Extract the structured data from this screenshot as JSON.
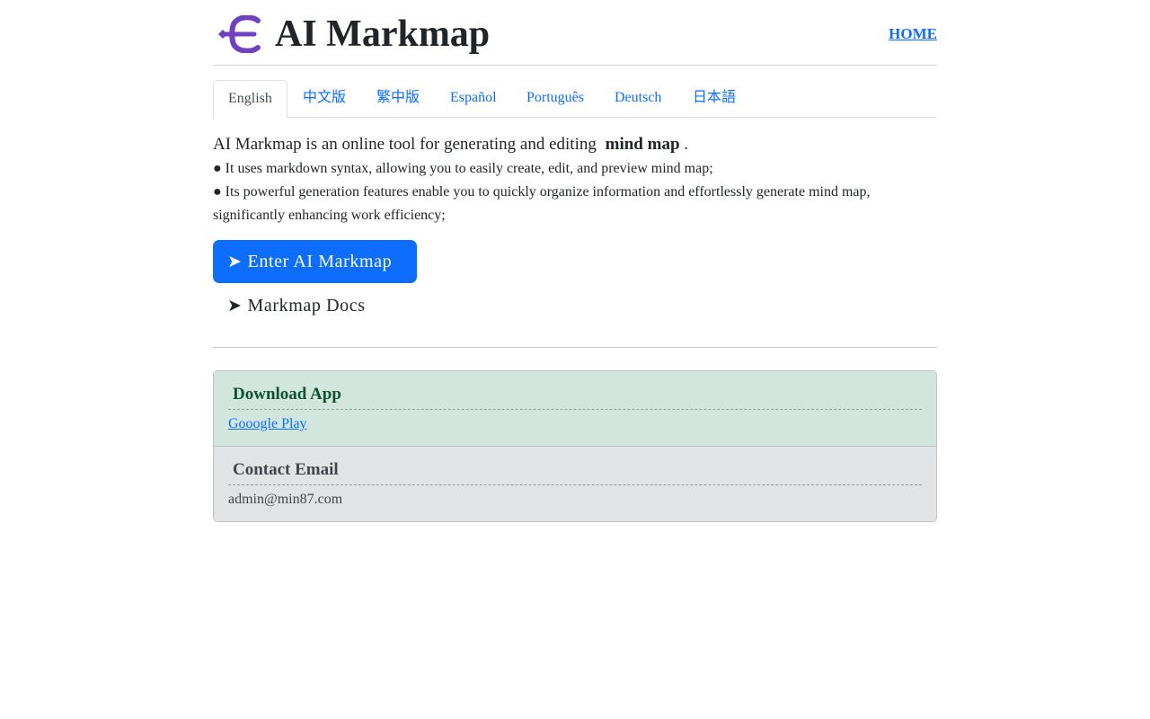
{
  "header": {
    "logo_icon": "purple-euro-arrow-logo",
    "title": "AI Markmap",
    "home_link": "HOME"
  },
  "tabs": [
    {
      "label": "English",
      "active": true
    },
    {
      "label": "中文版",
      "active": false
    },
    {
      "label": "繁中版",
      "active": false
    },
    {
      "label": "Español",
      "active": false
    },
    {
      "label": "Português",
      "active": false
    },
    {
      "label": "Deutsch",
      "active": false
    },
    {
      "label": "日本語",
      "active": false
    }
  ],
  "intro": {
    "headline_prefix": "AI Markmap is an online tool for generating and editing",
    "headline_bold": "mind map",
    "headline_suffix": ".",
    "bullet_1": "● It uses markdown syntax, allowing you to easily create, edit, and preview mind map;",
    "bullet_2": "● Its powerful generation features enable you to quickly organize information and effortlessly generate mind map, significantly enhancing work efficiency;"
  },
  "actions": {
    "enter_label": "Enter AI Markmap",
    "docs_label": "Markmap Docs",
    "arrow_glyph": "➤"
  },
  "panels": {
    "download": {
      "title": "Download App",
      "link": "Gooogle Play"
    },
    "contact": {
      "title": "Contact Email",
      "email": "admin@min87.com"
    }
  },
  "colors": {
    "accent": "#0d6efd",
    "logo": "#6f42c1",
    "success_bg": "#d1e7dd",
    "success_text": "#0f5132",
    "secondary_bg": "#e2e3e5"
  }
}
